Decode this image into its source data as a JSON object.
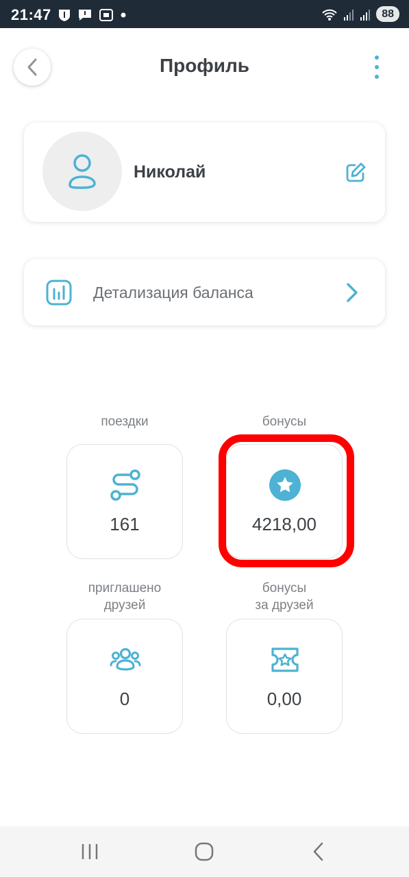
{
  "status_bar": {
    "time": "21:47",
    "battery": "88",
    "icons": [
      "shield-notification-icon",
      "message-icon",
      "screenshot-icon",
      "dot-icon",
      "wifi-icon",
      "signal-icon",
      "signal-icon"
    ]
  },
  "header": {
    "title": "Профиль"
  },
  "profile": {
    "name": "Николай"
  },
  "balance_details": {
    "label": "Детализация баланса"
  },
  "stats": [
    {
      "label": "поездки",
      "value": "161",
      "icon": "route-icon"
    },
    {
      "label": "бонусы",
      "value": "4218,00",
      "icon": "star-badge-icon"
    },
    {
      "label": "приглашено\nдрузей",
      "label_line1": "приглашено",
      "label_line2": "друзей",
      "value": "0",
      "icon": "group-icon"
    },
    {
      "label": "бонусы\nза друзей",
      "label_line1": "бонусы",
      "label_line2": "за друзей",
      "value": "0,00",
      "icon": "ticket-star-icon"
    }
  ],
  "colors": {
    "accent": "#4db2d3",
    "highlight": "#ff0000",
    "status_bar": "#1f2b37"
  }
}
